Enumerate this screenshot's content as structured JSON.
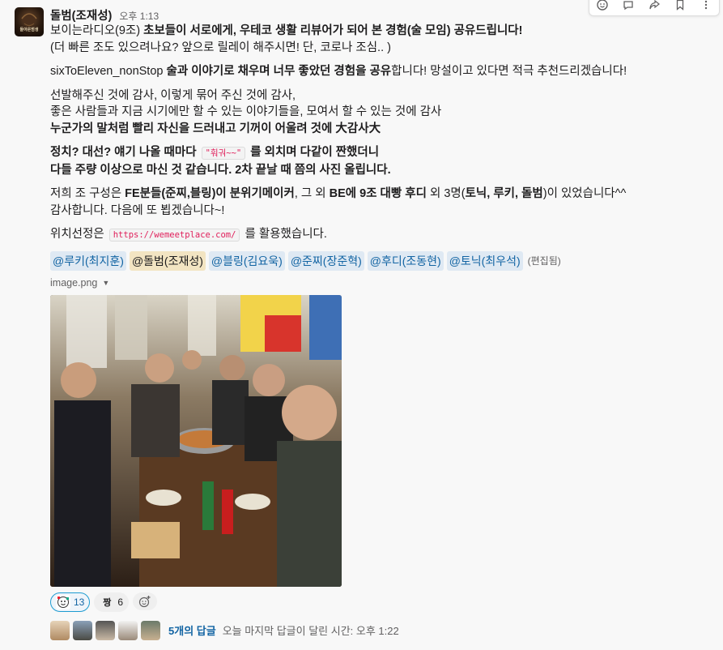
{
  "toolbar": {
    "icons": [
      "emoji-icon",
      "reply-thread-icon",
      "share-icon",
      "bookmark-icon",
      "more-icon"
    ]
  },
  "message": {
    "sender": "돌범(조재성)",
    "avatar_text": "돌아온범생",
    "time": "오후 1:13",
    "p1": {
      "prefix": "보이는라디오(9조) ",
      "bold": "초보들이 서로에게, 우테코 생활 리뷰어가 되어 본 경험(술 모임) 공유드립니다!",
      "line2": "(더 빠른 조도 있으려나요? 앞으로 릴레이 해주시면! 단, 코로나 조심.. )"
    },
    "p2": {
      "prefix": "sixToEleven_nonStop ",
      "bold": "술과 이야기로 채우며 너무 좋았던 경험을 공유",
      "suffix": "합니다! 망설이고 있다면 적극 추천드리겠습니다!"
    },
    "p3": {
      "line1": "선발해주신 것에 감사, 이렇게 묶어 주신 것에 감사,",
      "line2": "좋은 사람들과 지금 시기에만 할 수 있는 이야기들을, 모여서 할 수 있는 것에 감사",
      "line3": "누군가의 말처럼 빨리 자신을 드러내고 기꺼이 어울려 것에 大감사大"
    },
    "p4": {
      "line1_a": "정치? 대선? 얘기 나올 때마다 ",
      "code": "\"훠궈~~\"",
      "line1_b": " 를 외치며 다같이 짠했더니",
      "line2": "다들 주량 이상으로 마신 것 같습니다. 2차 끝날 때 쯤의 사진 올립니다."
    },
    "p5": {
      "a": "저희 조 구성은 ",
      "b": "FE분들(준찌,블링)이 분위기메이커",
      "c": ", 그 외 ",
      "d": "BE에 9조 대빵 후디",
      "e": " 외 3명(",
      "f": "토닉, 루키, 돌범",
      "g": ")이 있었습니다^^",
      "line2": "감사합니다. 다음에 또 뵙겠습니다~!"
    },
    "p6": {
      "prefix": "위치선정은 ",
      "code": "https://wemeetplace.com/",
      "suffix": " 를 활용했습니다."
    },
    "mentions": [
      "@루키(최지훈)",
      "@돌범(조재성)",
      "@블링(김요욱)",
      "@준찌(장준혁)",
      "@후디(조동현)",
      "@토닉(최우석)"
    ],
    "edited": "(편집됨)",
    "file_name": "image.png"
  },
  "reactions": [
    {
      "emoji": "party-face-icon",
      "count": "13"
    },
    {
      "emoji": "짱",
      "count": "6"
    }
  ],
  "thread": {
    "reply_count": "5개의 답글",
    "last_reply": "오늘 마지막 답글이 달린 시간: 오후 1:22"
  }
}
